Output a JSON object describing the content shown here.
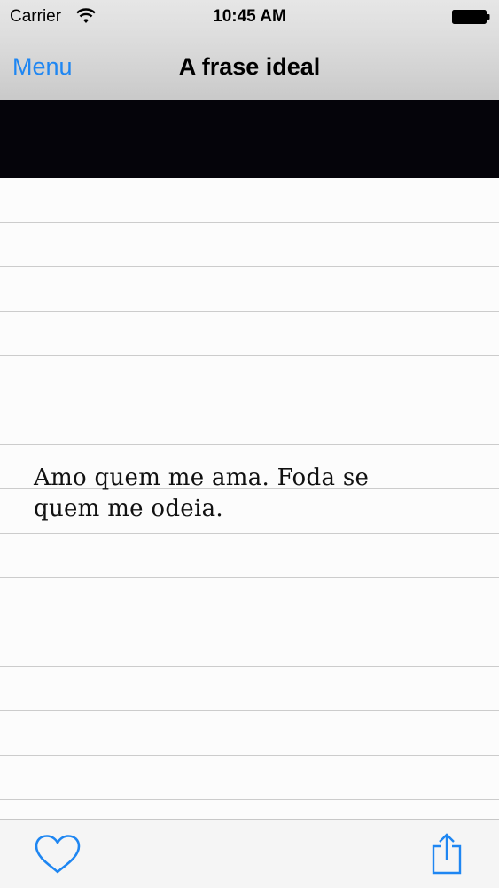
{
  "status_bar": {
    "carrier": "Carrier",
    "time": "10:45 AM",
    "wifi_icon": "wifi-icon",
    "battery_icon": "battery-full-icon"
  },
  "nav_bar": {
    "menu_label": "Menu",
    "title": "A frase ideal"
  },
  "content": {
    "quote_line1": "Amo quem me ama. Foda se",
    "quote_line2": "quem me odeia."
  },
  "toolbar": {
    "favorite_icon": "heart-icon",
    "share_icon": "share-icon"
  },
  "colors": {
    "accent": "#1e86f2",
    "band": "#05040a"
  }
}
